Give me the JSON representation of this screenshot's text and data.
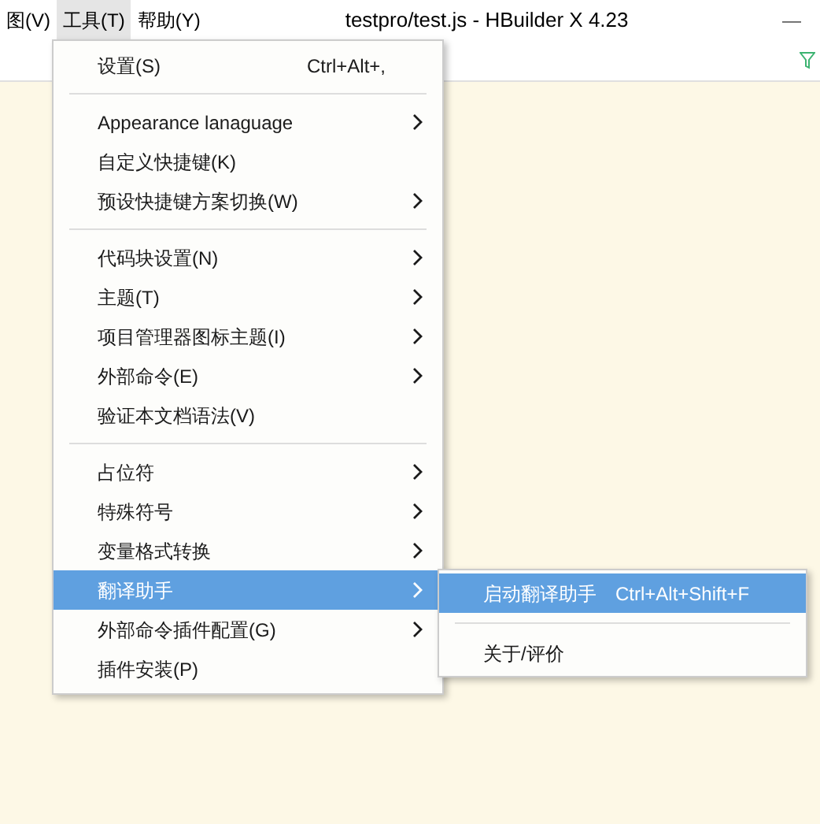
{
  "menubar": [
    {
      "label": "图(V)",
      "selected": false
    },
    {
      "label": "工具(T)",
      "selected": true
    },
    {
      "label": "帮助(Y)",
      "selected": false
    }
  ],
  "window": {
    "title": "testpro/test.js - HBuilder X 4.23",
    "minimize": "—"
  },
  "menu": {
    "groups": [
      [
        {
          "label": "设置(S)",
          "shortcut": "Ctrl+Alt+,",
          "submenu": false,
          "selected": false
        }
      ],
      [
        {
          "label": "Appearance lanaguage",
          "submenu": true,
          "selected": false
        },
        {
          "label": "自定义快捷键(K)",
          "submenu": false,
          "selected": false
        },
        {
          "label": "预设快捷键方案切换(W)",
          "submenu": true,
          "selected": false
        }
      ],
      [
        {
          "label": "代码块设置(N)",
          "submenu": true,
          "selected": false
        },
        {
          "label": "主题(T)",
          "submenu": true,
          "selected": false
        },
        {
          "label": "项目管理器图标主题(I)",
          "submenu": true,
          "selected": false
        },
        {
          "label": "外部命令(E)",
          "submenu": true,
          "selected": false
        },
        {
          "label": "验证本文档语法(V)",
          "submenu": false,
          "selected": false
        }
      ],
      [
        {
          "label": "占位符",
          "submenu": true,
          "selected": false
        },
        {
          "label": "特殊符号",
          "submenu": true,
          "selected": false
        },
        {
          "label": "变量格式转换",
          "submenu": true,
          "selected": false
        },
        {
          "label": "翻译助手",
          "submenu": true,
          "selected": true
        },
        {
          "label": "外部命令插件配置(G)",
          "submenu": true,
          "selected": false
        },
        {
          "label": "插件安装(P)",
          "submenu": false,
          "selected": false
        }
      ]
    ]
  },
  "submenu": {
    "groups": [
      [
        {
          "label": "启动翻译助手",
          "shortcut": "Ctrl+Alt+Shift+F",
          "selected": true
        }
      ],
      [
        {
          "label": "关于/评价",
          "selected": false
        }
      ]
    ]
  }
}
